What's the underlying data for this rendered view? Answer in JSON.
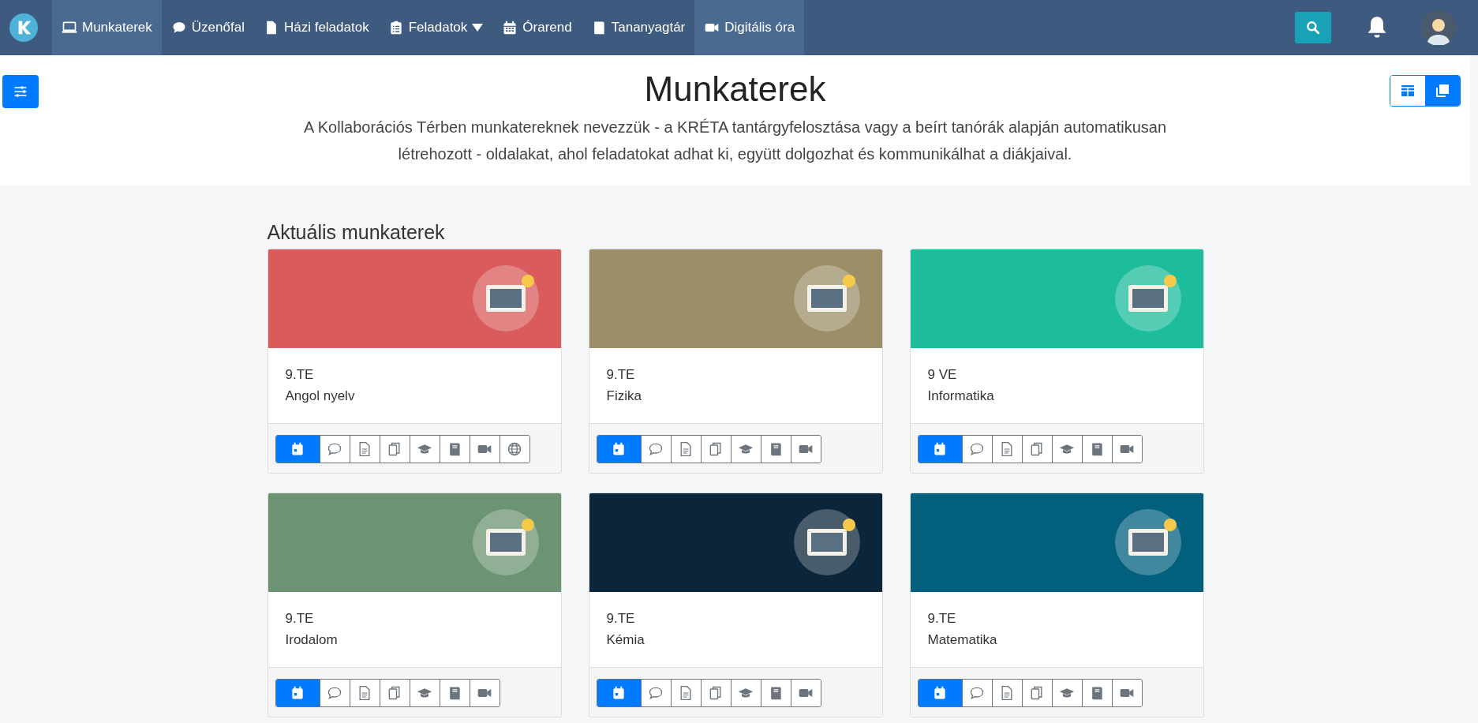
{
  "nav": {
    "items": [
      {
        "label": "Munkaterek",
        "kind": "laptop",
        "selected": true
      },
      {
        "label": "Üzenőfal",
        "kind": "chat",
        "selected": false
      },
      {
        "label": "Házi feladatok",
        "kind": "file",
        "selected": false
      },
      {
        "label": "Feladatok",
        "kind": "clipboard",
        "selected": false,
        "dropdown": true
      },
      {
        "label": "Órarend",
        "kind": "calendar",
        "selected": false
      },
      {
        "label": "Tananyagtár",
        "kind": "book",
        "selected": false
      },
      {
        "label": "Digitális óra",
        "kind": "video",
        "selected": true
      }
    ]
  },
  "header": {
    "title": "Munkaterek",
    "description": "A Kollaborációs Térben munkatereknek nevezzük - a KRÉTA tantárgyfelosztása vagy a beírt tanórák alapján automatikusan létrehozott - oldalakat, ahol feladatokat adhat ki, együtt dolgozhat és kommunikálhat a diákjaival.",
    "view_toggle": [
      {
        "kind": "grid",
        "selected": false
      },
      {
        "kind": "cards",
        "selected": true
      }
    ]
  },
  "section": {
    "title": "Aktuális munkaterek"
  },
  "cards": [
    {
      "class": "9.TE",
      "subject": "Angol nyelv",
      "color": "#d95b5b",
      "tools": [
        {
          "kind": "calendar",
          "selected": true
        },
        {
          "kind": "chat",
          "selected": false
        },
        {
          "kind": "file",
          "selected": false
        },
        {
          "kind": "copy",
          "selected": false
        },
        {
          "kind": "cap",
          "selected": false
        },
        {
          "kind": "book",
          "selected": false
        },
        {
          "kind": "video",
          "selected": false
        },
        {
          "kind": "globe",
          "selected": false
        }
      ]
    },
    {
      "class": "9.TE",
      "subject": "Fizika",
      "color": "#9c8f68",
      "tools": [
        {
          "kind": "calendar",
          "selected": true
        },
        {
          "kind": "chat",
          "selected": false
        },
        {
          "kind": "file",
          "selected": false
        },
        {
          "kind": "copy",
          "selected": false
        },
        {
          "kind": "cap",
          "selected": false
        },
        {
          "kind": "book",
          "selected": false
        },
        {
          "kind": "video",
          "selected": false
        }
      ]
    },
    {
      "class": "9 VE",
      "subject": "Informatika",
      "color": "#1dbc9b",
      "tools": [
        {
          "kind": "calendar",
          "selected": true
        },
        {
          "kind": "chat",
          "selected": false
        },
        {
          "kind": "file",
          "selected": false
        },
        {
          "kind": "copy",
          "selected": false
        },
        {
          "kind": "cap",
          "selected": false
        },
        {
          "kind": "book",
          "selected": false
        },
        {
          "kind": "video",
          "selected": false
        }
      ]
    },
    {
      "class": "9.TE",
      "subject": "Irodalom",
      "color": "#6d9472",
      "tools": [
        {
          "kind": "calendar",
          "selected": true
        },
        {
          "kind": "chat",
          "selected": false
        },
        {
          "kind": "file",
          "selected": false
        },
        {
          "kind": "copy",
          "selected": false
        },
        {
          "kind": "cap",
          "selected": false
        },
        {
          "kind": "book",
          "selected": false
        },
        {
          "kind": "video",
          "selected": false
        }
      ]
    },
    {
      "class": "9.TE",
      "subject": "Kémia",
      "color": "#0b263b",
      "tools": [
        {
          "kind": "calendar",
          "selected": true
        },
        {
          "kind": "chat",
          "selected": false
        },
        {
          "kind": "file",
          "selected": false
        },
        {
          "kind": "copy",
          "selected": false
        },
        {
          "kind": "cap",
          "selected": false
        },
        {
          "kind": "book",
          "selected": false
        },
        {
          "kind": "video",
          "selected": false
        }
      ]
    },
    {
      "class": "9.TE",
      "subject": "Matematika",
      "color": "#02607e",
      "tools": [
        {
          "kind": "calendar",
          "selected": true
        },
        {
          "kind": "chat",
          "selected": false
        },
        {
          "kind": "file",
          "selected": false
        },
        {
          "kind": "copy",
          "selected": false
        },
        {
          "kind": "cap",
          "selected": false
        },
        {
          "kind": "book",
          "selected": false
        },
        {
          "kind": "video",
          "selected": false
        }
      ]
    }
  ]
}
